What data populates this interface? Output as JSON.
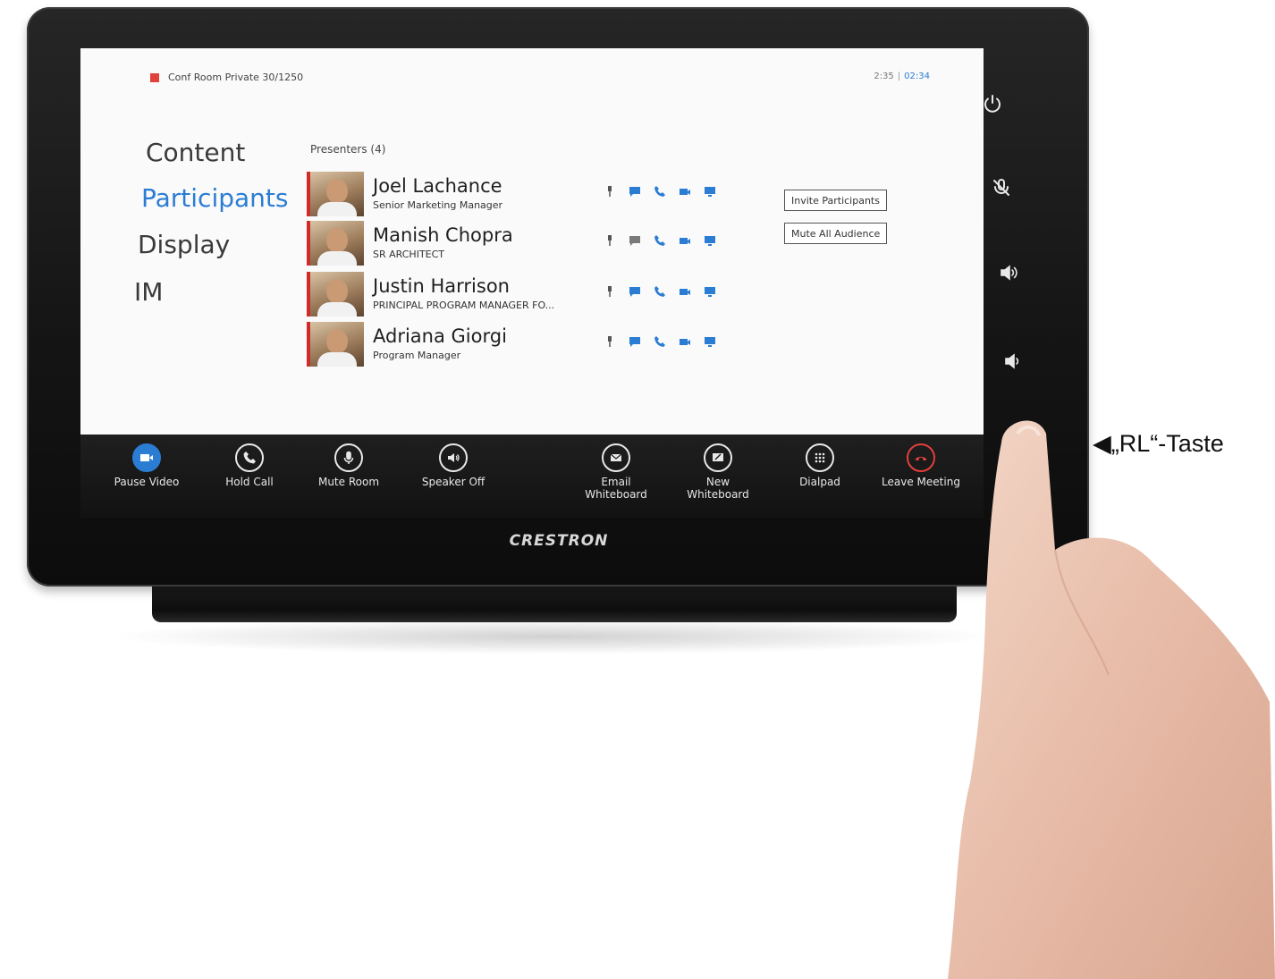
{
  "status": {
    "room": "Conf Room Private 30/1250",
    "time": "2:35",
    "elapsed": "02:34"
  },
  "nav": [
    {
      "label": "Content"
    },
    {
      "label": "Participants",
      "active": true
    },
    {
      "label": "Display"
    },
    {
      "label": "IM"
    }
  ],
  "presenters": {
    "header": "Presenters (4)",
    "list": [
      {
        "name": "Joel Lachance",
        "title": "Senior Marketing Manager"
      },
      {
        "name": "Manish Chopra",
        "title": "SR ARCHITECT"
      },
      {
        "name": "Justin Harrison",
        "title": "PRINCIPAL PROGRAM MANAGER FO..."
      },
      {
        "name": "Adriana Giorgi",
        "title": "Program Manager"
      }
    ]
  },
  "actions": {
    "invite": "Invite Participants",
    "mute_all": "Mute All Audience"
  },
  "controls": [
    {
      "label": "Pause Video",
      "icon": "video-camera-icon"
    },
    {
      "label": "Hold Call",
      "icon": "phone-icon"
    },
    {
      "label": "Mute Room",
      "icon": "microphone-icon"
    },
    {
      "label": "Speaker Off",
      "icon": "speaker-icon"
    },
    {
      "label": "Email\nWhiteboard",
      "icon": "email-icon"
    },
    {
      "label": "New\nWhiteboard",
      "icon": "whiteboard-icon"
    },
    {
      "label": "Dialpad",
      "icon": "dialpad-icon"
    },
    {
      "label": "Leave Meeting",
      "icon": "hang-up-icon"
    }
  ],
  "hardware_buttons": [
    "power-icon",
    "mic-mute-icon",
    "volume-up-icon",
    "volume-down-icon"
  ],
  "brand": "CRESTRON",
  "annotation": "◀„RL“-Taste",
  "colors": {
    "accent": "#2b7cd3",
    "alert": "#e2403a",
    "bezel": "#141414"
  }
}
